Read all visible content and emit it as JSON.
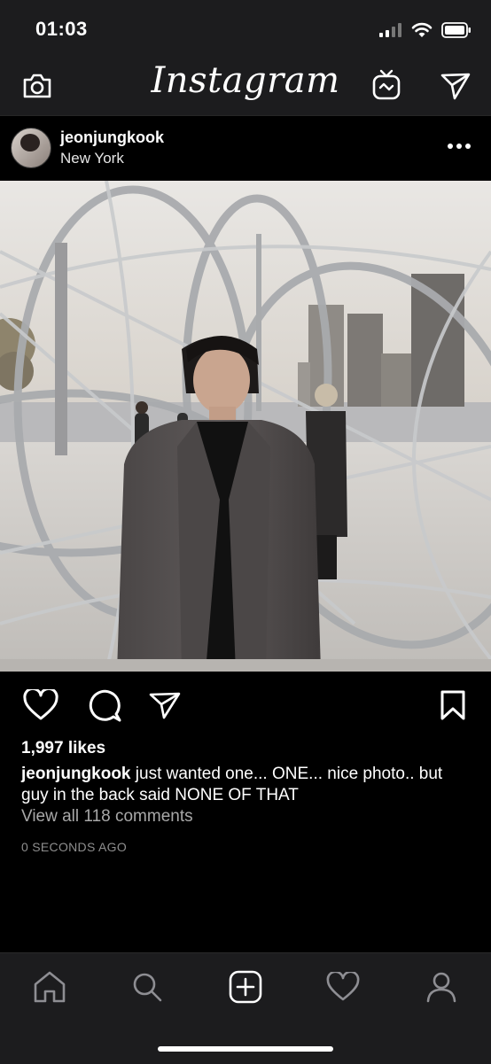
{
  "status": {
    "time": "01:03"
  },
  "nav": {
    "logo": "Instagram"
  },
  "post": {
    "username": "jeonjungkook",
    "location": "New York",
    "likes": "1,997 likes",
    "caption_user": "jeonjungkook",
    "caption_text": " just wanted one... ONE... nice photo.. but guy in the back said NONE OF THAT",
    "view_comments": "View all 118 comments",
    "time_ago": "0 SECONDS AGO"
  },
  "icons": {
    "camera": "camera-icon",
    "igtv": "igtv-icon",
    "direct": "paper-plane-icon",
    "like": "heart-icon",
    "comment": "comment-icon",
    "share": "share-icon",
    "save": "bookmark-icon",
    "home": "home-icon",
    "search": "search-icon",
    "add": "add-post-icon",
    "activity": "heart-icon",
    "profile": "profile-icon"
  }
}
